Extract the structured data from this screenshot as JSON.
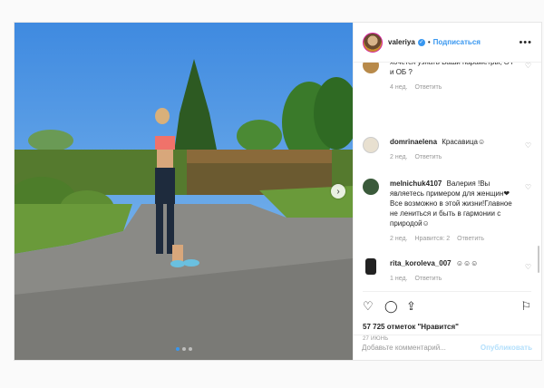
{
  "post": {
    "header": {
      "username": "valeriya",
      "follow_label": "Подписаться",
      "more_label": "•••"
    },
    "comments": [
      {
        "username": "",
        "text": "хочется узнать Ваши параметры, ОТ и ОБ ?",
        "time": "4 нед.",
        "reply": "Ответить",
        "likes": ""
      },
      {
        "username": "domrinaelena",
        "text": "Красавица☺",
        "time": "2 нед.",
        "reply": "Ответить",
        "likes": ""
      },
      {
        "username": "melnichuk4107",
        "text": "Валерия !Вы являетесь примером для женщин❤Все возможно в этой жизни!Главное не лениться и быть в гармонии с природой☺",
        "time": "2 нед.",
        "reply": "Ответить",
        "likes": "Нравится: 2"
      },
      {
        "username": "rita_koroleva_007",
        "text": "☺☺☺",
        "time": "1 нед.",
        "reply": "Ответить",
        "likes": ""
      }
    ],
    "likes_text": "57 725 отметок \"Нравится\"",
    "date": "27 ИЮНЬ",
    "add_comment_placeholder": "Добавьте комментарий...",
    "publish_label": "Опубликовать"
  },
  "icons": {
    "like": "heart-icon",
    "comment": "comment-icon",
    "share": "share-icon",
    "save": "bookmark-icon",
    "next": "chevron-right-icon"
  },
  "colors": {
    "accent": "#3897f0",
    "publish_disabled": "#b2dffc"
  }
}
